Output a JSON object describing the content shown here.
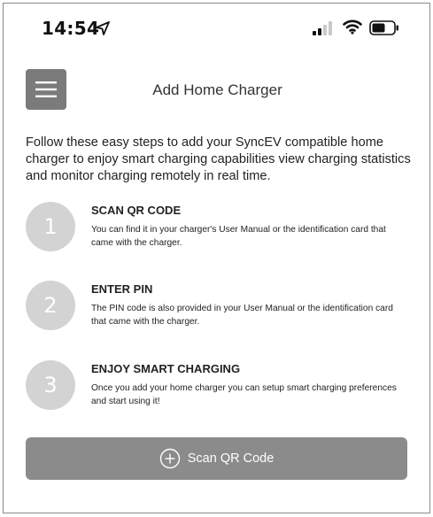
{
  "status_bar": {
    "time": "14:54",
    "icons": [
      "location-arrow-icon",
      "cellular-signal-icon",
      "wifi-icon",
      "battery-icon"
    ]
  },
  "header": {
    "menu_icon": "hamburger-menu-icon",
    "title": "Add Home Charger"
  },
  "intro": "Follow these easy steps to add your SyncEV compatible home charger to enjoy smart charging capabilities view charging statistics and monitor charging remotely in real time.",
  "steps": [
    {
      "number": "1",
      "title": "SCAN QR CODE",
      "description": "You can find it in your charger's User Manual or the identification card that came with the charger."
    },
    {
      "number": "2",
      "title": "ENTER PIN",
      "description": "The PIN code is also provided in your User Manual or the identification card that came with the charger."
    },
    {
      "number": "3",
      "title": "ENJOY SMART CHARGING",
      "description": "Once you add your home charger you can setup smart charging preferences and start using it!"
    }
  ],
  "scan_button": {
    "icon": "plus-circle-icon",
    "label": "Scan QR Code"
  },
  "colors": {
    "button_bg": "#8b8b8b",
    "menu_bg": "#7b7b7b",
    "step_circle": "#d3d3d3"
  }
}
